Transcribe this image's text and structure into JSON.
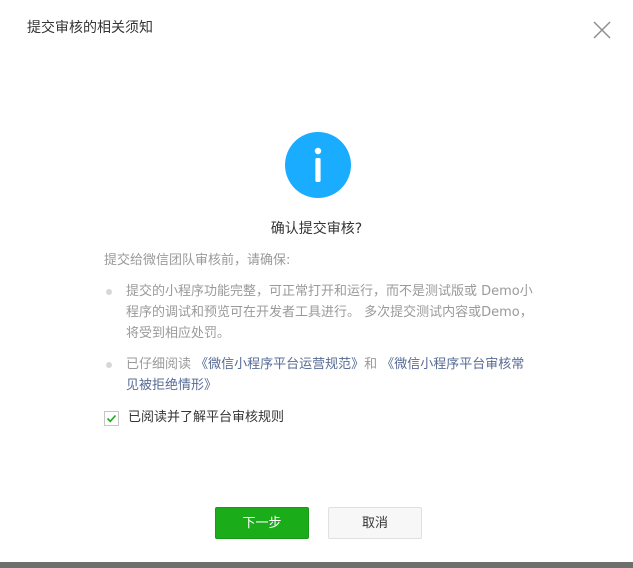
{
  "dialog": {
    "title": "提交审核的相关须知",
    "close_icon": "close-icon"
  },
  "notice": {
    "icon": "info-icon",
    "icon_color": "#1aadff",
    "heading": "确认提交审核?",
    "intro": "提交给微信团队审核前，请确保:",
    "bullet1": "提交的小程序功能完整，可正常打开和运行，而不是测试版或 Demo小程序的调试和预览可在开发者工具进行。 多次提交测试内容或Demo，将受到相应处罚。",
    "bullet2_prefix": "已仔细阅读 ",
    "rule_link_1": "《微信小程序平台运营规范》",
    "bullet2_joiner": "和 ",
    "rule_link_2": "《微信小程序平台审核常见被拒绝情形》"
  },
  "agreement": {
    "checked": true,
    "label": "已阅读并了解平台审核规则"
  },
  "buttons": {
    "next_label": "下一步",
    "cancel_label": "取消",
    "primary_color": "#1aad19"
  }
}
